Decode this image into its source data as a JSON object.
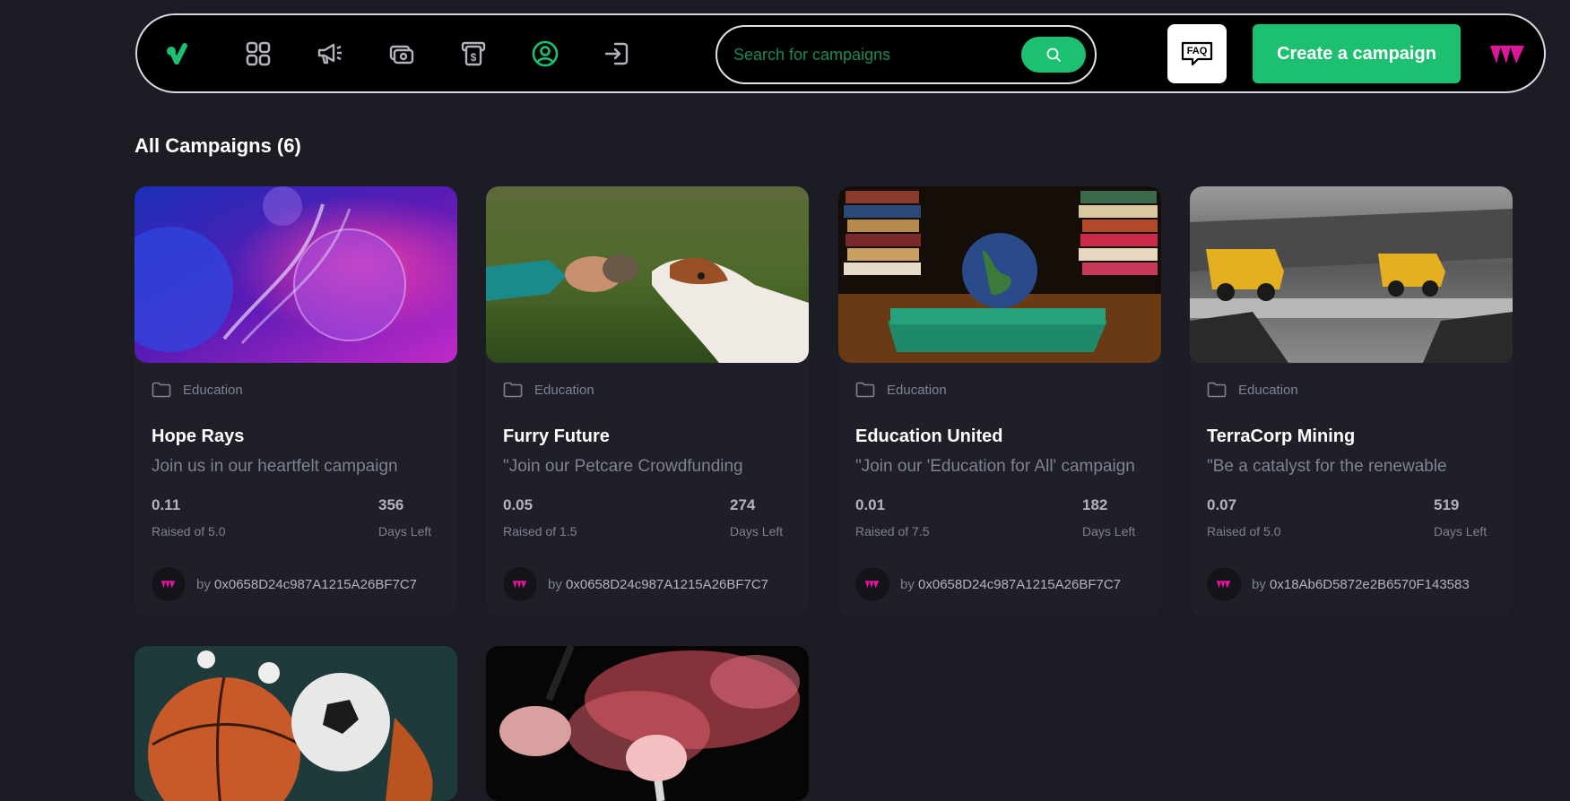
{
  "nav": {
    "search_placeholder": "Search for campaigns",
    "faq_label": "FAQ",
    "create_label": "Create a campaign",
    "icons": [
      "dashboard-icon",
      "campaign-megaphone-icon",
      "payment-icon",
      "withdraw-icon",
      "profile-icon",
      "logout-icon"
    ],
    "active_icon": "profile-icon"
  },
  "colors": {
    "accent": "#1dc071",
    "brand": "#e0159b",
    "background": "#1c1c24",
    "card": "#1f1f29"
  },
  "section": {
    "title": "All Campaigns (6)"
  },
  "campaigns": [
    {
      "category": "Education",
      "title": "Hope Rays",
      "description": "Join us in our heartfelt campaign",
      "raised": "0.11",
      "raised_label": "Raised of 5.0",
      "days": "356",
      "days_label": "Days Left",
      "by_label": "by",
      "owner": "0x0658D24c987A1215A26BF7C7"
    },
    {
      "category": "Education",
      "title": "Furry Future",
      "description": "\"Join our Petcare Crowdfunding",
      "raised": "0.05",
      "raised_label": "Raised of 1.5",
      "days": "274",
      "days_label": "Days Left",
      "by_label": "by",
      "owner": "0x0658D24c987A1215A26BF7C7"
    },
    {
      "category": "Education",
      "title": "Education United",
      "description": "\"Join our 'Education for All' campaign",
      "raised": "0.01",
      "raised_label": "Raised of 7.5",
      "days": "182",
      "days_label": "Days Left",
      "by_label": "by",
      "owner": "0x0658D24c987A1215A26BF7C7"
    },
    {
      "category": "Education",
      "title": "TerraCorp Mining",
      "description": "\"Be a catalyst for the renewable",
      "raised": "0.07",
      "raised_label": "Raised of 5.0",
      "days": "519",
      "days_label": "Days Left",
      "by_label": "by",
      "owner": "0x18Ab6D5872e2B6570F143583"
    }
  ]
}
